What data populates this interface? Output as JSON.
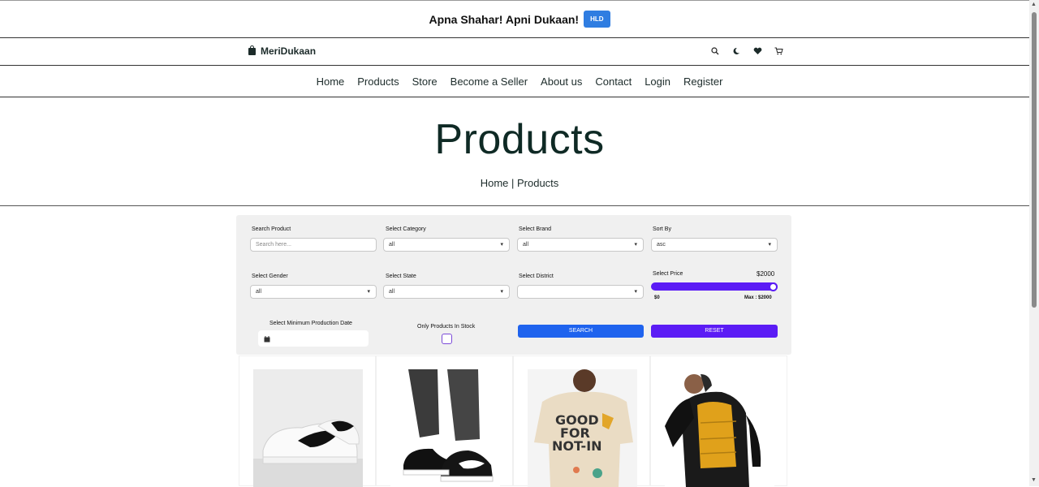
{
  "announcement": {
    "tagline": "Apna Shahar! Apni Dukaan!",
    "badge": "HLD"
  },
  "brand": {
    "name": "MeriDukaan"
  },
  "header_icons": [
    "search-icon",
    "moon-icon",
    "heart-icon",
    "cart-icon"
  ],
  "nav": [
    "Home",
    "Products",
    "Store",
    "Become a Seller",
    "About us",
    "Contact",
    "Login",
    "Register"
  ],
  "hero": {
    "title": "Products",
    "breadcrumb": "Home | Products"
  },
  "filters": {
    "search_label": "Search Product",
    "search_placeholder": "Search here...",
    "category_label": "Select Category",
    "category_value": "all",
    "brand_label": "Select Brand",
    "brand_value": "all",
    "sort_label": "Sort By",
    "sort_value": "asc",
    "gender_label": "Select Gender",
    "gender_value": "all",
    "state_label": "Select State",
    "state_value": "all",
    "district_label": "Select District",
    "district_value": "",
    "price_label": "Select Price",
    "price_value": "$2000",
    "price_min": "$0",
    "price_max": "Max : $2000",
    "price_level": 1.0,
    "date_label": "Select Minimum Production Date",
    "stock_label": "Only Products In Stock",
    "search_button": "SEARCH",
    "reset_button": "RESET"
  },
  "colors": {
    "accent_purple": "#5b1cf5",
    "search_blue": "#1f63ee",
    "badge_blue": "#2f7de1",
    "heading": "#0f2a25"
  },
  "products": [
    "white-sneakers",
    "black-sneakers",
    "printed-tshirt",
    "puffer-vest"
  ]
}
